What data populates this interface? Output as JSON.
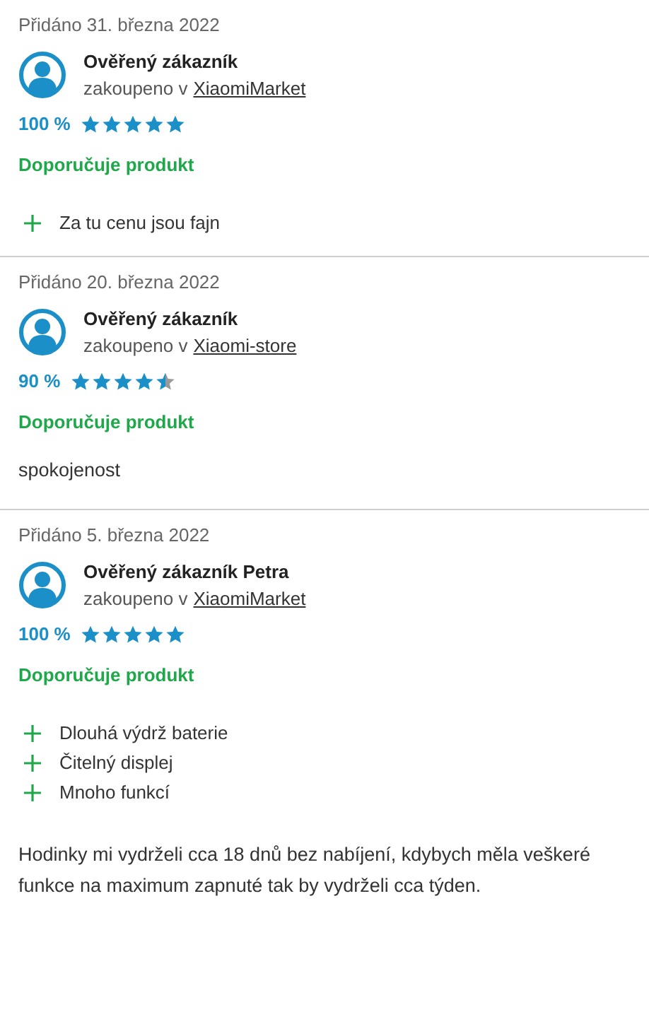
{
  "reviews": [
    {
      "date": "Přidáno 31. března 2022",
      "author": "Ověřený zákazník",
      "purchased_prefix": "zakoupeno v",
      "shop": "XiaomiMarket",
      "percent": "100 %",
      "stars": 5,
      "recommendation": "Doporučuje produkt",
      "pros": [
        "Za tu cenu jsou fajn"
      ]
    },
    {
      "date": "Přidáno 20. března 2022",
      "author": "Ověřený zákazník",
      "purchased_prefix": "zakoupeno v",
      "shop": "Xiaomi-store",
      "percent": "90 %",
      "stars": 4.5,
      "recommendation": "Doporučuje produkt",
      "text": "spokojenost"
    },
    {
      "date": "Přidáno 5. března 2022",
      "author": "Ověřený zákazník Petra",
      "purchased_prefix": "zakoupeno v",
      "shop": "XiaomiMarket",
      "percent": "100 %",
      "stars": 5,
      "recommendation": "Doporučuje produkt",
      "pros": [
        "Dlouhá výdrž baterie",
        "Čitelný displej",
        "Mnoho funkcí"
      ],
      "text": "Hodinky mi vydrželi cca 18 dnů bez nabíjení, kdybych měla veškeré funkce na maximum zapnuté tak by vydrželi cca týden."
    }
  ]
}
